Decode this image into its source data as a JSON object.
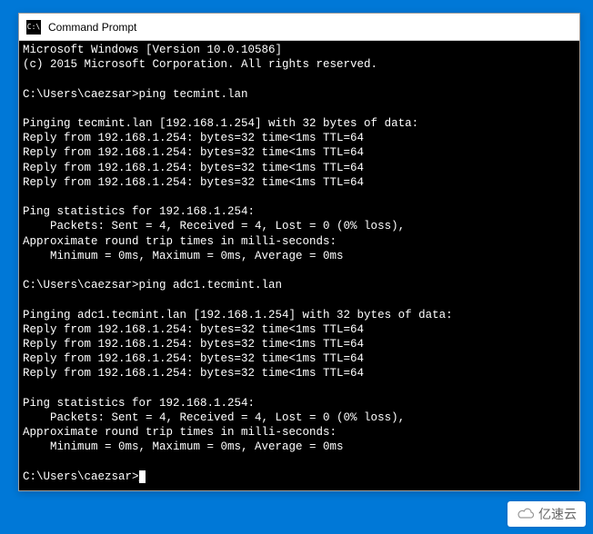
{
  "window": {
    "title": "Command Prompt",
    "icon_label": "C:\\"
  },
  "terminal": {
    "lines": [
      "Microsoft Windows [Version 10.0.10586]",
      "(c) 2015 Microsoft Corporation. All rights reserved.",
      "",
      "C:\\Users\\caezsar>ping tecmint.lan",
      "",
      "Pinging tecmint.lan [192.168.1.254] with 32 bytes of data:",
      "Reply from 192.168.1.254: bytes=32 time<1ms TTL=64",
      "Reply from 192.168.1.254: bytes=32 time<1ms TTL=64",
      "Reply from 192.168.1.254: bytes=32 time<1ms TTL=64",
      "Reply from 192.168.1.254: bytes=32 time<1ms TTL=64",
      "",
      "Ping statistics for 192.168.1.254:",
      "    Packets: Sent = 4, Received = 4, Lost = 0 (0% loss),",
      "Approximate round trip times in milli-seconds:",
      "    Minimum = 0ms, Maximum = 0ms, Average = 0ms",
      "",
      "C:\\Users\\caezsar>ping adc1.tecmint.lan",
      "",
      "Pinging adc1.tecmint.lan [192.168.1.254] with 32 bytes of data:",
      "Reply from 192.168.1.254: bytes=32 time<1ms TTL=64",
      "Reply from 192.168.1.254: bytes=32 time<1ms TTL=64",
      "Reply from 192.168.1.254: bytes=32 time<1ms TTL=64",
      "Reply from 192.168.1.254: bytes=32 time<1ms TTL=64",
      "",
      "Ping statistics for 192.168.1.254:",
      "    Packets: Sent = 4, Received = 4, Lost = 0 (0% loss),",
      "Approximate round trip times in milli-seconds:",
      "    Minimum = 0ms, Maximum = 0ms, Average = 0ms",
      "",
      "C:\\Users\\caezsar>"
    ],
    "prompt_cursor": "_"
  },
  "watermark": {
    "text": "亿速云"
  }
}
